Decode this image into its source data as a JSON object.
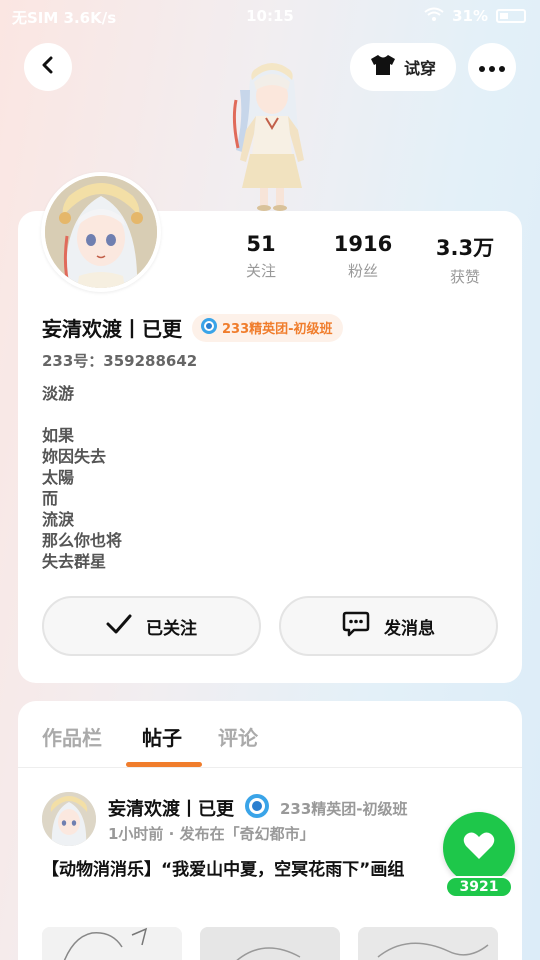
{
  "status_bar": {
    "left_text": "无SIM 3.6K/s",
    "time": "10:15",
    "battery": "31%"
  },
  "header": {
    "tryon_label": "试穿"
  },
  "profile": {
    "stats": [
      {
        "value": "51",
        "label": "关注"
      },
      {
        "value": "1916",
        "label": "粉丝"
      },
      {
        "value": "3.3万",
        "label": "获赞"
      }
    ],
    "name": "妄清欢渡丨已更",
    "badge": "233精英团-初级班",
    "uid": "233号：359288642",
    "bio_lines": [
      "淡游",
      "",
      "如果",
      "妳因失去",
      "太陽",
      "而",
      "流淚",
      "那么你也将",
      "失去群星"
    ],
    "follow_label": "已关注",
    "message_label": "发消息"
  },
  "tabs": [
    {
      "label": "作品栏",
      "active": false
    },
    {
      "label": "帖子",
      "active": true
    },
    {
      "label": "评论",
      "active": false
    }
  ],
  "post": {
    "author": "妄清欢渡丨已更",
    "tag": "233精英团-初级班",
    "meta": "1小时前 · 发布在「奇幻都市」",
    "title": "【动物消消乐】“我爱山中夏，空冥花雨下”画组",
    "likes": "3921"
  },
  "colors": {
    "accent": "#f07d2c",
    "like_green": "#1ec74a"
  }
}
